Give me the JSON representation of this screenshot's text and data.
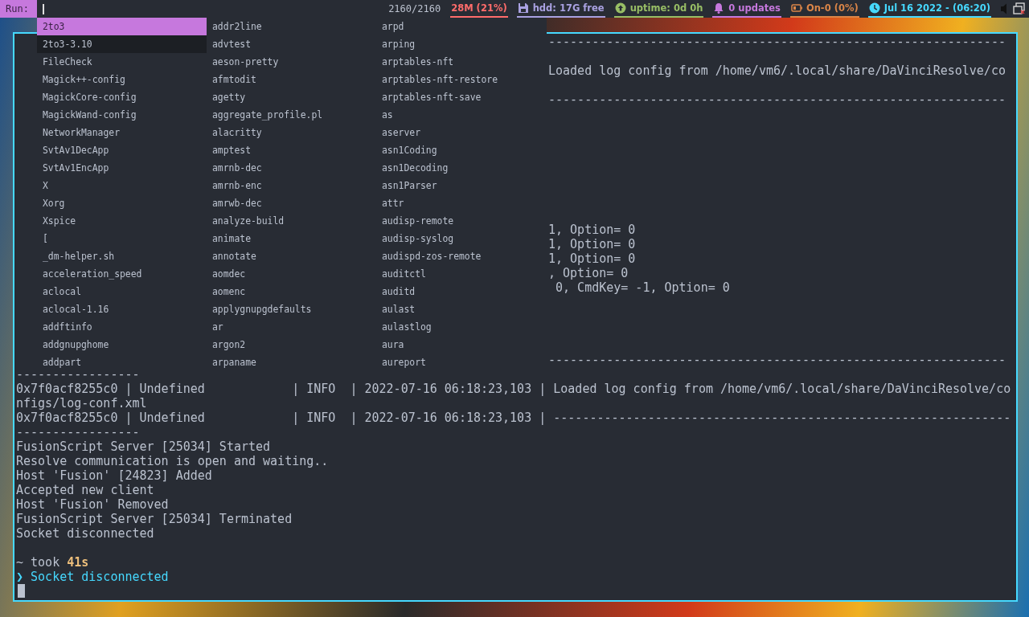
{
  "run_prompt": {
    "label": "Run:",
    "counter": "2160/2160"
  },
  "status_widgets": [
    {
      "kind": "memory",
      "text": "28M (21%)",
      "color": "#ff6c6b"
    },
    {
      "kind": "disk",
      "text": "hdd: 17G free",
      "color": "#a9a1e1"
    },
    {
      "kind": "uptime",
      "text": "uptime: 0d 0h",
      "color": "#98be65"
    },
    {
      "kind": "updates",
      "text": "0 updates",
      "color": "#c678dd"
    },
    {
      "kind": "battery",
      "text": "On-0 (0%)",
      "color": "#da8548"
    },
    {
      "kind": "clock",
      "text": "Jul 16 2022 - (06:20)",
      "color": "#46d9ff"
    }
  ],
  "run_menu": {
    "items": [
      {
        "label": "2to3",
        "selected": true,
        "hovered": false
      },
      {
        "label": "2to3-3.10",
        "selected": false,
        "hovered": true
      },
      {
        "label": "FileCheck",
        "selected": false,
        "hovered": false
      },
      {
        "label": "Magick++-config",
        "selected": false,
        "hovered": false
      },
      {
        "label": "MagickCore-config",
        "selected": false,
        "hovered": false
      },
      {
        "label": "MagickWand-config",
        "selected": false,
        "hovered": false
      },
      {
        "label": "NetworkManager",
        "selected": false,
        "hovered": false
      },
      {
        "label": "SvtAv1DecApp",
        "selected": false,
        "hovered": false
      },
      {
        "label": "SvtAv1EncApp",
        "selected": false,
        "hovered": false
      },
      {
        "label": "X",
        "selected": false,
        "hovered": false
      },
      {
        "label": "Xorg",
        "selected": false,
        "hovered": false
      },
      {
        "label": "Xspice",
        "selected": false,
        "hovered": false
      },
      {
        "label": "[",
        "selected": false,
        "hovered": false
      },
      {
        "label": "_dm-helper.sh",
        "selected": false,
        "hovered": false
      },
      {
        "label": "acceleration_speed",
        "selected": false,
        "hovered": false
      },
      {
        "label": "aclocal",
        "selected": false,
        "hovered": false
      },
      {
        "label": "aclocal-1.16",
        "selected": false,
        "hovered": false
      },
      {
        "label": "addftinfo",
        "selected": false,
        "hovered": false
      },
      {
        "label": "addgnupghome",
        "selected": false,
        "hovered": false
      },
      {
        "label": "addpart",
        "selected": false,
        "hovered": false
      },
      {
        "label": "addr2line",
        "selected": false,
        "hovered": false
      },
      {
        "label": "advtest",
        "selected": false,
        "hovered": false
      },
      {
        "label": "aeson-pretty",
        "selected": false,
        "hovered": false
      },
      {
        "label": "afmtodit",
        "selected": false,
        "hovered": false
      },
      {
        "label": "agetty",
        "selected": false,
        "hovered": false
      },
      {
        "label": "aggregate_profile.pl",
        "selected": false,
        "hovered": false
      },
      {
        "label": "alacritty",
        "selected": false,
        "hovered": false
      },
      {
        "label": "amptest",
        "selected": false,
        "hovered": false
      },
      {
        "label": "amrnb-dec",
        "selected": false,
        "hovered": false
      },
      {
        "label": "amrnb-enc",
        "selected": false,
        "hovered": false
      },
      {
        "label": "amrwb-dec",
        "selected": false,
        "hovered": false
      },
      {
        "label": "analyze-build",
        "selected": false,
        "hovered": false
      },
      {
        "label": "animate",
        "selected": false,
        "hovered": false
      },
      {
        "label": "annotate",
        "selected": false,
        "hovered": false
      },
      {
        "label": "aomdec",
        "selected": false,
        "hovered": false
      },
      {
        "label": "aomenc",
        "selected": false,
        "hovered": false
      },
      {
        "label": "applygnupgdefaults",
        "selected": false,
        "hovered": false
      },
      {
        "label": "ar",
        "selected": false,
        "hovered": false
      },
      {
        "label": "argon2",
        "selected": false,
        "hovered": false
      },
      {
        "label": "arpaname",
        "selected": false,
        "hovered": false
      },
      {
        "label": "arpd",
        "selected": false,
        "hovered": false
      },
      {
        "label": "arping",
        "selected": false,
        "hovered": false
      },
      {
        "label": "arptables-nft",
        "selected": false,
        "hovered": false
      },
      {
        "label": "arptables-nft-restore",
        "selected": false,
        "hovered": false
      },
      {
        "label": "arptables-nft-save",
        "selected": false,
        "hovered": false
      },
      {
        "label": "as",
        "selected": false,
        "hovered": false
      },
      {
        "label": "aserver",
        "selected": false,
        "hovered": false
      },
      {
        "label": "asn1Coding",
        "selected": false,
        "hovered": false
      },
      {
        "label": "asn1Decoding",
        "selected": false,
        "hovered": false
      },
      {
        "label": "asn1Parser",
        "selected": false,
        "hovered": false
      },
      {
        "label": "attr",
        "selected": false,
        "hovered": false
      },
      {
        "label": "audisp-remote",
        "selected": false,
        "hovered": false
      },
      {
        "label": "audisp-syslog",
        "selected": false,
        "hovered": false
      },
      {
        "label": "audispd-zos-remote",
        "selected": false,
        "hovered": false
      },
      {
        "label": "auditctl",
        "selected": false,
        "hovered": false
      },
      {
        "label": "auditd",
        "selected": false,
        "hovered": false
      },
      {
        "label": "aulast",
        "selected": false,
        "hovered": false
      },
      {
        "label": "aulastlog",
        "selected": false,
        "hovered": false
      },
      {
        "label": "aura",
        "selected": false,
        "hovered": false
      },
      {
        "label": "aureport",
        "selected": false,
        "hovered": false
      }
    ]
  },
  "terminal": {
    "lines": [
      {
        "kind": "covered",
        "text": "---------------------------------------------------------------"
      },
      {
        "kind": "blank"
      },
      {
        "kind": "covered",
        "text": "Loaded log config from /home/vm6/.local/share/DaVinciResolve/co"
      },
      {
        "kind": "blank"
      },
      {
        "kind": "covered",
        "text": "---------------------------------------------------------------"
      },
      {
        "kind": "blank"
      },
      {
        "kind": "blank"
      },
      {
        "kind": "blank"
      },
      {
        "kind": "blank"
      },
      {
        "kind": "blank"
      },
      {
        "kind": "blank"
      },
      {
        "kind": "blank"
      },
      {
        "kind": "blank"
      },
      {
        "kind": "covered",
        "text": "1, Option= 0"
      },
      {
        "kind": "covered",
        "text": "1, Option= 0"
      },
      {
        "kind": "covered",
        "text": "1, Option= 0"
      },
      {
        "kind": "covered",
        "text": ", Option= 0"
      },
      {
        "kind": "covered",
        "text": " 0, CmdKey= -1, Option= 0"
      },
      {
        "kind": "blank"
      },
      {
        "kind": "blank"
      },
      {
        "kind": "blank"
      },
      {
        "kind": "blank"
      },
      {
        "kind": "covered",
        "text": "---------------------------------------------------------------"
      },
      {
        "kind": "text",
        "text": "-----------------"
      },
      {
        "kind": "text",
        "text": "0x7f0acf8255c0 | Undefined            | INFO  | 2022-07-16 06:18:23,103 | Loaded log config from /home/vm6/.local/share/DaVinciResolve/co"
      },
      {
        "kind": "text",
        "text": "nfigs/log-conf.xml"
      },
      {
        "kind": "text",
        "text": "0x7f0acf8255c0 | Undefined            | INFO  | 2022-07-16 06:18:23,103 | ---------------------------------------------------------------"
      },
      {
        "kind": "text",
        "text": "-----------------"
      },
      {
        "kind": "text",
        "text": "FusionScript Server [25034] Started"
      },
      {
        "kind": "text",
        "text": "Resolve communication is open and waiting.."
      },
      {
        "kind": "text",
        "text": "Host 'Fusion' [24823] Added"
      },
      {
        "kind": "text",
        "text": "Accepted new client"
      },
      {
        "kind": "text",
        "text": "Host 'Fusion' Removed"
      },
      {
        "kind": "text",
        "text": "FusionScript Server [25034] Terminated"
      },
      {
        "kind": "text",
        "text": "Socket disconnected"
      },
      {
        "kind": "blank"
      },
      {
        "kind": "status",
        "dir": "~",
        "label": "took",
        "duration": "41s"
      },
      {
        "kind": "prompt",
        "symbol": "❯",
        "command": "Socket disconnected"
      },
      {
        "kind": "cursor"
      }
    ]
  }
}
